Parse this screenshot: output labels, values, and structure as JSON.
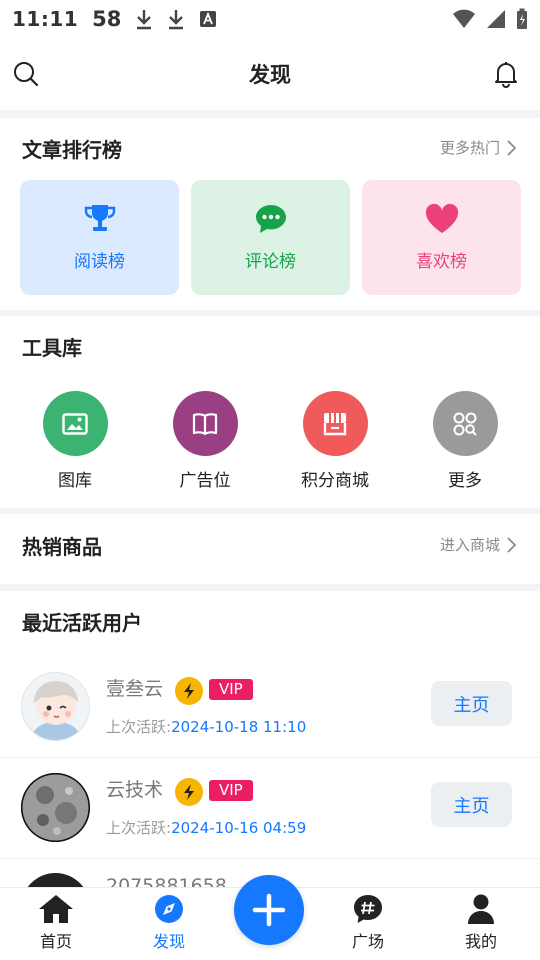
{
  "status_bar": {
    "time": "11:11",
    "indicator": "58"
  },
  "header": {
    "title": "发现"
  },
  "ranking": {
    "title": "文章排行榜",
    "more": "更多热门",
    "cards": [
      {
        "label": "阅读榜",
        "icon": "trophy-icon",
        "bg": "#dbeafe",
        "color": "#1677ff"
      },
      {
        "label": "评论榜",
        "icon": "chat-bubble-icon",
        "bg": "#dcf2e4",
        "color": "#16a34a"
      },
      {
        "label": "喜欢榜",
        "icon": "heart-icon",
        "bg": "#fde4ea",
        "color": "#ec407a"
      }
    ]
  },
  "tools": {
    "title": "工具库",
    "items": [
      {
        "label": "图库",
        "icon": "image-icon",
        "color": "#3cb371"
      },
      {
        "label": "广告位",
        "icon": "book-icon",
        "color": "#9b3f84"
      },
      {
        "label": "积分商城",
        "icon": "store-icon",
        "color": "#f05a5a"
      },
      {
        "label": "更多",
        "icon": "grid-search-icon",
        "color": "#9a9a9a"
      }
    ]
  },
  "hot_products": {
    "title": "热销商品",
    "more": "进入商城"
  },
  "active_users": {
    "title": "最近活跃用户",
    "last_active_label": "上次活跃:",
    "home_label": "主页",
    "vip_label": "VIP",
    "users": [
      {
        "name": "壹叁云",
        "last_active": "2024-10-18 11:10"
      },
      {
        "name": "云技术",
        "last_active": "2024-10-16 04:59"
      },
      {
        "name": "2075881658"
      }
    ]
  },
  "bottom_nav": {
    "items": [
      {
        "label": "首页",
        "icon": "home-icon"
      },
      {
        "label": "发现",
        "icon": "compass-icon",
        "active": true
      },
      {
        "label": "广场",
        "icon": "hashtag-icon"
      },
      {
        "label": "我的",
        "icon": "user-icon"
      }
    ],
    "fab_icon": "plus-icon",
    "accent": "#1677ff"
  }
}
